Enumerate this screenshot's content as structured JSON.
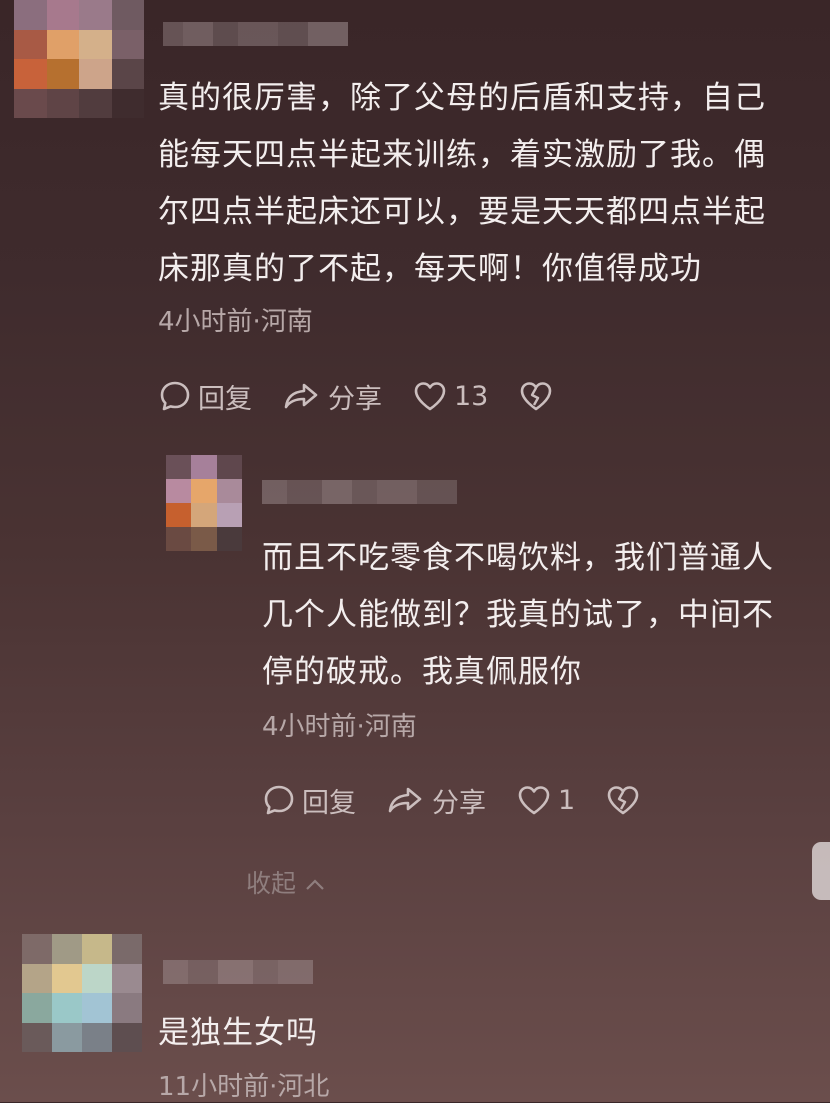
{
  "comments": [
    {
      "text_lines": [
        "真的很厉害，除了父母的后盾和支持，自己",
        "能每天四点半起来训练，着实激励了我。偶",
        "尔四点半起床还可以，要是天天都四点半起",
        "床那真的了不起，每天啊！你值得成功"
      ],
      "meta": "4小时前·河南",
      "reply_label": "回复",
      "share_label": "分享",
      "likes": "13"
    },
    {
      "text_lines": [
        "而且不吃零食不喝饮料，我们普通人",
        "几个人能做到？我真的试了，中间不",
        "停的破戒。我真佩服你"
      ],
      "meta": "4小时前·河南",
      "reply_label": "回复",
      "share_label": "分享",
      "likes": "1"
    },
    {
      "text_lines": [
        "是独生女吗"
      ],
      "meta": "11小时前·河北"
    }
  ],
  "collapse_label": "收起",
  "collapse_icon": "chevron-up-icon",
  "icons": [
    "comment-icon",
    "share-icon",
    "heart-icon",
    "broken-heart-icon"
  ]
}
